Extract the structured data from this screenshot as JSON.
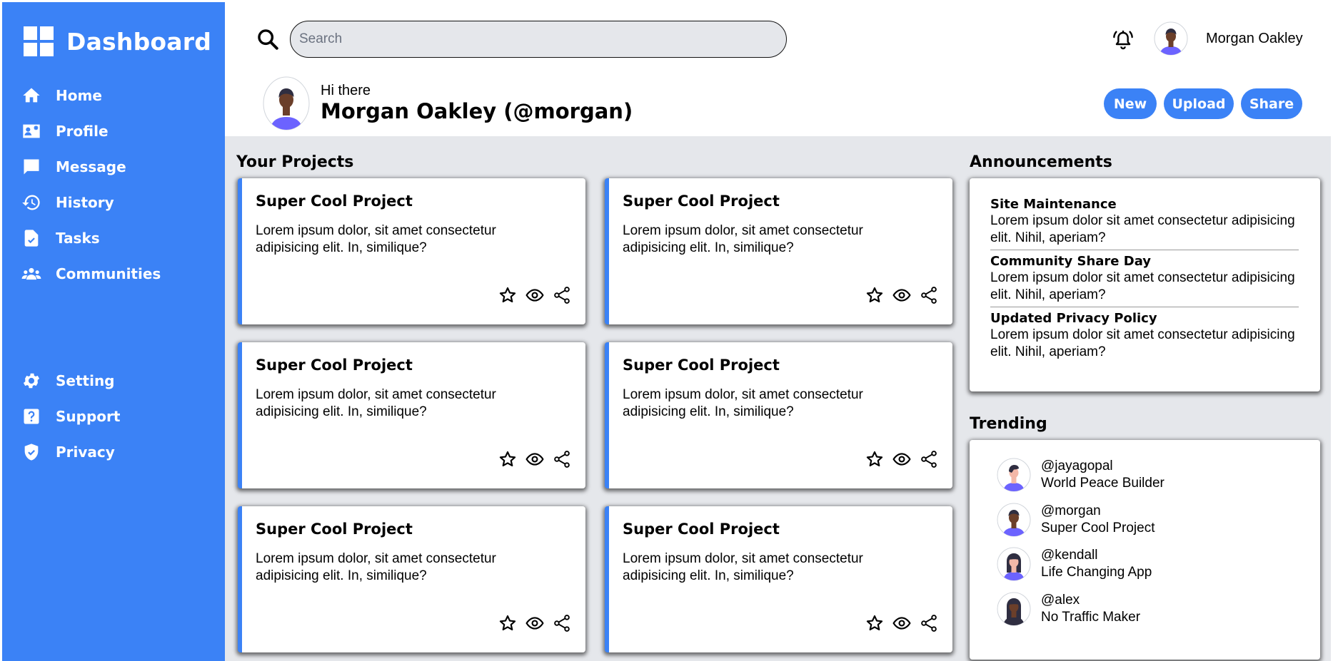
{
  "sidebar": {
    "title": "Dashboard",
    "items": [
      {
        "label": "Home",
        "icon": "home-icon"
      },
      {
        "label": "Profile",
        "icon": "profile-card-icon"
      },
      {
        "label": "Message",
        "icon": "message-icon"
      },
      {
        "label": "History",
        "icon": "history-icon"
      },
      {
        "label": "Tasks",
        "icon": "tasks-icon"
      },
      {
        "label": "Communities",
        "icon": "communities-icon"
      }
    ],
    "bottom_items": [
      {
        "label": "Setting",
        "icon": "gear-icon"
      },
      {
        "label": "Support",
        "icon": "question-icon"
      },
      {
        "label": "Privacy",
        "icon": "shield-icon"
      }
    ]
  },
  "header": {
    "search_placeholder": "Search",
    "username": "Morgan Oakley",
    "greeting": "Hi there",
    "full_name": "Morgan Oakley (@morgan)",
    "buttons": {
      "new": "New",
      "upload": "Upload",
      "share": "Share"
    }
  },
  "projects": {
    "title": "Your Projects",
    "items": [
      {
        "title": "Super Cool Project",
        "desc": "Lorem ipsum dolor, sit amet consectetur adipisicing elit. In, similique?"
      },
      {
        "title": "Super Cool Project",
        "desc": "Lorem ipsum dolor, sit amet consectetur adipisicing elit. In, similique?"
      },
      {
        "title": "Super Cool Project",
        "desc": "Lorem ipsum dolor, sit amet consectetur adipisicing elit. In, similique?"
      },
      {
        "title": "Super Cool Project",
        "desc": "Lorem ipsum dolor, sit amet consectetur adipisicing elit. In, similique?"
      },
      {
        "title": "Super Cool Project",
        "desc": "Lorem ipsum dolor, sit amet consectetur adipisicing elit. In, similique?"
      },
      {
        "title": "Super Cool Project",
        "desc": "Lorem ipsum dolor, sit amet consectetur adipisicing elit. In, similique?"
      }
    ]
  },
  "announcements": {
    "title": "Announcements",
    "items": [
      {
        "title": "Site Maintenance",
        "body": "Lorem ipsum dolor sit amet consectetur adipisicing elit. Nihil, aperiam?"
      },
      {
        "title": "Community Share Day",
        "body": "Lorem ipsum dolor sit amet consectetur adipisicing elit. Nihil, aperiam?"
      },
      {
        "title": "Updated Privacy Policy",
        "body": "Lorem ipsum dolor sit amet consectetur adipisicing elit. Nihil, aperiam?"
      }
    ]
  },
  "trending": {
    "title": "Trending",
    "items": [
      {
        "handle": "@jayagopal",
        "project": "World Peace Builder"
      },
      {
        "handle": "@morgan",
        "project": "Super Cool Project"
      },
      {
        "handle": "@kendall",
        "project": "Life Changing App"
      },
      {
        "handle": "@alex",
        "project": "No Traffic Maker"
      }
    ]
  },
  "colors": {
    "accent": "#3b82f6",
    "main_bg": "#e5e7eb",
    "avatar_shirt": "#6c63ff"
  }
}
